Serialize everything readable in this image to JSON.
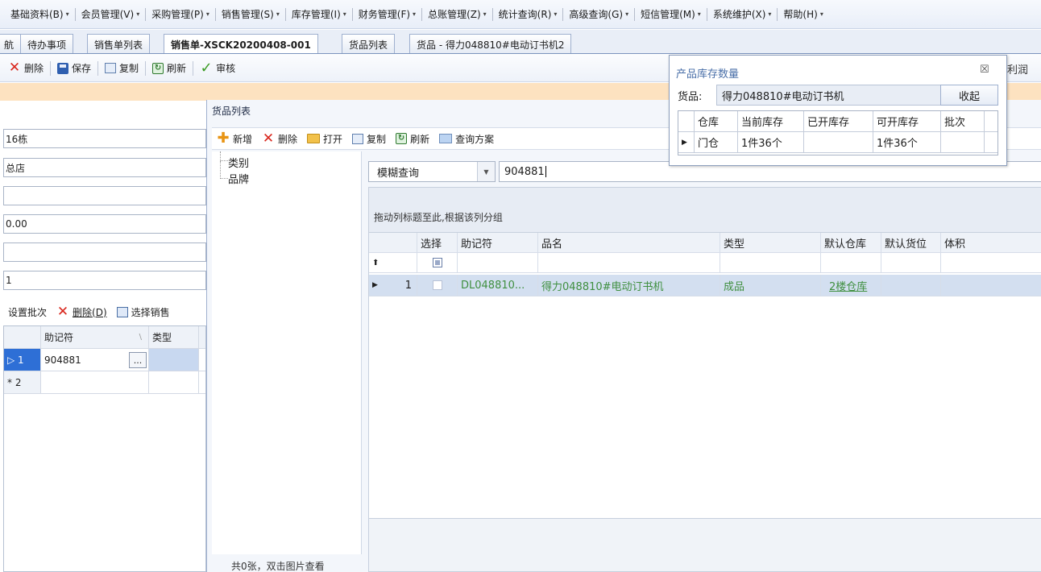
{
  "menubar": {
    "items": [
      {
        "label": "基础资料(B)"
      },
      {
        "label": "会员管理(V)"
      },
      {
        "label": "采购管理(P)"
      },
      {
        "label": "销售管理(S)"
      },
      {
        "label": "库存管理(I)"
      },
      {
        "label": "财务管理(F)"
      },
      {
        "label": "总账管理(Z)"
      },
      {
        "label": "统计查询(R)"
      },
      {
        "label": "高级查询(G)"
      },
      {
        "label": "短信管理(M)"
      },
      {
        "label": "系统维护(X)"
      },
      {
        "label": "帮助(H)"
      }
    ]
  },
  "doc_tabs": [
    {
      "label": "航"
    },
    {
      "label": "待办事项"
    },
    {
      "label": "销售单列表"
    },
    {
      "label": "销售单-XSCK20200408-001"
    },
    {
      "label": "货品列表"
    },
    {
      "label": "货品 - 得力048810#电动订书机2"
    }
  ],
  "toolbar": {
    "delete": "删除",
    "save": "保存",
    "copy": "复制",
    "refresh": "刷新",
    "audit": "审核",
    "profit": "利润"
  },
  "form_fields": [
    "16栋",
    "总店",
    "",
    "0.00",
    "",
    "1"
  ],
  "batch_toolbar": {
    "set_batch": "设置批次",
    "delete": "删除(D)",
    "select_sale": "选择销售"
  },
  "batch_grid": {
    "headers": [
      "助记符",
      "类型"
    ],
    "rows": [
      {
        "indicator": "▷ 1",
        "code": "904881",
        "ellipsis": "..."
      },
      {
        "indicator": "* 2",
        "code": ""
      }
    ]
  },
  "goods_window": {
    "title": "货品列表",
    "toolbar": {
      "add": "新增",
      "delete": "删除",
      "open": "打开",
      "copy": "复制",
      "refresh": "刷新",
      "query_plan": "查询方案"
    },
    "tree": [
      "类别",
      "品牌"
    ],
    "footer": "共0张，双击图片查看",
    "search": {
      "mode": "模糊查询",
      "value": "904881"
    },
    "grid": {
      "group_hint": "拖动列标题至此,根据该列分组",
      "headers": [
        "选择",
        "助记符",
        "品名",
        "类型",
        "默认仓库",
        "默认货位",
        "体积"
      ],
      "filter_icon": "⬆",
      "rows": [
        {
          "num": "1",
          "code": "DL048810...",
          "name": "得力048810#电动订书机",
          "type": "成品",
          "warehouse": "2楼仓库",
          "location": "",
          "volume": ""
        }
      ]
    }
  },
  "stock_popup": {
    "title": "产品库存数量",
    "close": "☒",
    "product_label": "货品:",
    "product_name": "得力048810#电动订书机",
    "collapse": "收起",
    "headers": [
      "仓库",
      "当前库存",
      "已开库存",
      "可开库存",
      "批次"
    ],
    "rows": [
      {
        "warehouse": "门仓",
        "current": "1件36个",
        "opened": "",
        "available": "1件36个",
        "batch": ""
      }
    ]
  },
  "icons": {
    "delete": "x-icon",
    "save": "floppy-icon",
    "copy": "copy-icon",
    "refresh": "refresh-icon",
    "audit": "check-icon",
    "add": "plus-icon",
    "open": "folder-icon",
    "query": "query-icon"
  },
  "colors": {
    "accent_orange": "#fde2c0",
    "delete_red": "#d9261c",
    "selected_row": "#d3dff0",
    "link_green": "#3f8f3f"
  }
}
